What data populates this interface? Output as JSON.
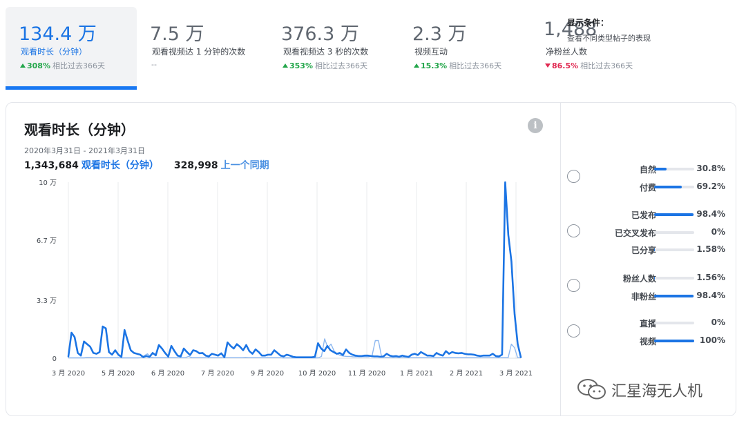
{
  "metrics": [
    {
      "value": "134.4 万",
      "label": "观看时长（分钟）",
      "delta": "308%",
      "direction": "up",
      "suffix": "相比过去366天",
      "active": true
    },
    {
      "value": "7.5 万",
      "label": "观看视频达 1 分钟的次数",
      "delta": "",
      "direction": "none",
      "suffix": "--",
      "active": false
    },
    {
      "value": "376.3 万",
      "label": "观看视频达 3 秒的次数",
      "delta": "353%",
      "direction": "up",
      "suffix": "相比过去366天",
      "active": false
    },
    {
      "value": "2.3 万",
      "label": "视频互动",
      "delta": "15.3%",
      "direction": "up",
      "suffix": "相比过去366天",
      "active": false
    },
    {
      "value": "1,488",
      "label": "净粉丝人数",
      "delta": "86.5%",
      "direction": "down",
      "suffix": "相比过去366天",
      "active": false
    }
  ],
  "card": {
    "title": "观看时长（分钟）",
    "info_icon": "i",
    "date_range": "2020年3月31日 - 2021年3月31日",
    "total_current": "1,343,684",
    "total_current_label": "观看时长（分钟）",
    "total_previous": "328,998",
    "total_previous_label": "上一个同期"
  },
  "chart_data": {
    "type": "line",
    "y_ticks": [
      {
        "value": 100000,
        "label": "10 万"
      },
      {
        "value": 67000,
        "label": "6.7 万"
      },
      {
        "value": 33000,
        "label": "3.3 万"
      },
      {
        "value": 0,
        "label": "0"
      }
    ],
    "ylim": [
      0,
      100000
    ],
    "x_ticks": [
      "3 月 2020",
      "5 月 2020",
      "6 月 2020",
      "7 月 2020",
      "9 月 2020",
      "10 月 2020",
      "11 月 2020",
      "1 月 2021",
      "2 月 2021",
      "3 月 2021"
    ],
    "grid": "vertical",
    "series": [
      {
        "name": "观看时长（分钟）",
        "color": "#1b74e4",
        "values": [
          1000,
          14500,
          12000,
          3000,
          1500,
          9500,
          8000,
          6500,
          3000,
          2500,
          3500,
          18000,
          17000,
          3500,
          2000,
          4500,
          2000,
          800,
          16000,
          10000,
          4500,
          3000,
          2500,
          2000,
          600,
          1200,
          700,
          3000,
          1600,
          7500,
          5500,
          3000,
          900,
          7000,
          4000,
          1500,
          1000,
          5500,
          3500,
          1800,
          4500,
          4000,
          2800,
          3000,
          1500,
          1000,
          2500,
          2000,
          1500,
          2800,
          600,
          9000,
          7000,
          5500,
          8000,
          6500,
          4500,
          7500,
          4000,
          2500,
          5000,
          3500,
          1500,
          1500,
          2000,
          2000,
          4500,
          3000,
          1500,
          1000,
          2000,
          1500,
          800,
          500,
          500,
          500,
          500,
          500,
          500,
          800,
          8500,
          5500,
          4000,
          7000,
          4500,
          3500,
          2500,
          3000,
          1800,
          5000,
          3000,
          2000,
          1500,
          1200,
          1200,
          1500,
          1500,
          1200,
          1000,
          1000,
          800,
          1000,
          2500,
          1500,
          1000,
          1200,
          800,
          1500,
          1000,
          700,
          2000,
          2500,
          1800,
          3500,
          2500,
          1500,
          1500,
          1200,
          3000,
          2000,
          1500,
          4000,
          2500,
          3500,
          3000,
          2800,
          3000,
          2500,
          2200,
          2200,
          2000,
          1500,
          1200,
          1500,
          1500,
          1500,
          2500,
          1200,
          1000,
          2000,
          100000,
          70000,
          55000,
          25000,
          8000,
          600
        ]
      },
      {
        "name": "上一个同期",
        "color": "#8db8f0",
        "values": [
          200,
          200,
          200,
          200,
          200,
          200,
          500,
          500,
          300,
          300,
          300,
          300,
          300,
          300,
          300,
          300,
          300,
          200,
          200,
          200,
          200,
          200,
          200,
          300,
          1500,
          2500,
          600,
          300,
          300,
          300,
          300,
          300,
          300,
          300,
          300,
          300,
          300,
          300,
          1000,
          300,
          300,
          300,
          300,
          300,
          300,
          300,
          300,
          300,
          300,
          300,
          300,
          300,
          300,
          300,
          300,
          300,
          500,
          300,
          300,
          300,
          300,
          300,
          300,
          300,
          300,
          300,
          300,
          300,
          200,
          200,
          200,
          200,
          200,
          200,
          200,
          200,
          200,
          200,
          200,
          200,
          1000,
          11000,
          6000,
          8000,
          4000,
          2500,
          1500,
          1200,
          1000,
          1000,
          800,
          800,
          800,
          800,
          800,
          800,
          1500,
          10000,
          10000,
          500,
          500,
          500,
          500,
          500,
          500,
          500,
          500,
          500,
          300,
          300,
          300,
          300,
          300,
          300,
          300,
          300,
          300,
          300,
          300,
          300,
          300,
          300,
          300,
          300,
          300,
          300,
          300,
          300,
          300,
          300,
          300,
          300,
          300,
          300,
          300,
          300,
          300,
          300,
          300,
          300,
          8000,
          6000,
          300,
          300
        ]
      }
    ]
  },
  "filters": {
    "title": "显示条件：",
    "subtitle": "查看不同类型帖子的表现",
    "groups": [
      {
        "rows": [
          {
            "label": "自然",
            "value": "30.8%",
            "pct": 30.8
          },
          {
            "label": "付费",
            "value": "69.2%",
            "pct": 69.2
          }
        ]
      },
      {
        "rows": [
          {
            "label": "已发布",
            "value": "98.4%",
            "pct": 98.4
          },
          {
            "label": "已交叉发布",
            "value": "0%",
            "pct": 0
          },
          {
            "label": "已分享",
            "value": "1.58%",
            "pct": 1.58
          }
        ]
      },
      {
        "rows": [
          {
            "label": "粉丝人数",
            "value": "1.56%",
            "pct": 1.56
          },
          {
            "label": "非粉丝",
            "value": "98.4%",
            "pct": 98.4
          }
        ]
      },
      {
        "rows": [
          {
            "label": "直播",
            "value": "0%",
            "pct": 0
          },
          {
            "label": "视频",
            "value": "100%",
            "pct": 100
          }
        ]
      }
    ]
  },
  "watermark": {
    "text": "汇星海无人机",
    "icon": "wechat-icon"
  }
}
